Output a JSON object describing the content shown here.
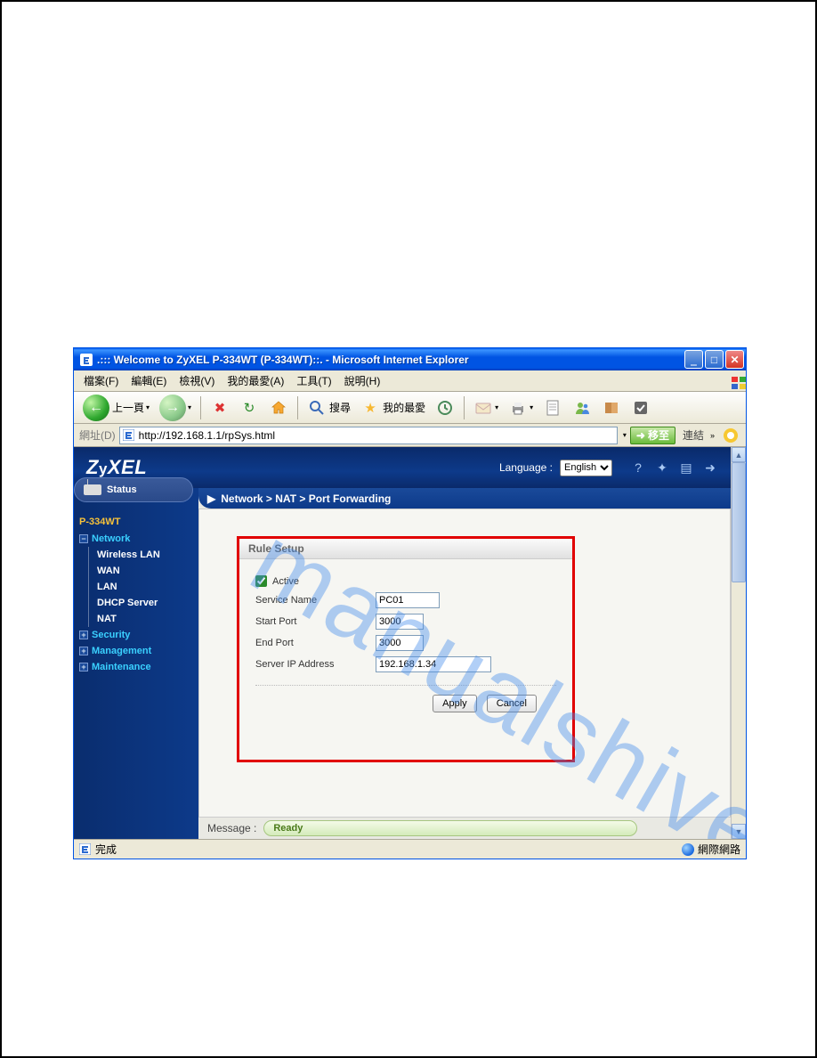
{
  "window": {
    "title": ".::: Welcome to ZyXEL P-334WT (P-334WT)::. - Microsoft Internet Explorer"
  },
  "menu": {
    "file": "檔案(F)",
    "edit": "編輯(E)",
    "view": "檢視(V)",
    "favorites": "我的最愛(A)",
    "tools": "工具(T)",
    "help": "說明(H)"
  },
  "toolbar": {
    "back": "上一頁",
    "search": "搜尋",
    "favorites": "我的最愛"
  },
  "addressbar": {
    "label": "網址(D)",
    "url": "http://192.168.1.1/rpSys.html",
    "go": "移至",
    "links": "連結"
  },
  "router": {
    "logo": "ZyXEL",
    "language_label": "Language :",
    "language_value": "English",
    "breadcrumb": "Network > NAT > Port Forwarding",
    "status": "Status",
    "device": "P-334WT",
    "nav": {
      "network": "Network",
      "wireless": "Wireless LAN",
      "wan": "WAN",
      "lan": "LAN",
      "dhcp": "DHCP Server",
      "nat": "NAT",
      "security": "Security",
      "management": "Management",
      "maintenance": "Maintenance"
    },
    "rule": {
      "title": "Rule Setup",
      "active": "Active",
      "service_name_label": "Service Name",
      "service_name_value": "PC01",
      "start_port_label": "Start Port",
      "start_port_value": "3000",
      "end_port_label": "End Port",
      "end_port_value": "3000",
      "server_ip_label": "Server IP Address",
      "server_ip_value": "192.168.1.34",
      "apply": "Apply",
      "cancel": "Cancel"
    },
    "message_label": "Message :",
    "message_value": "Ready"
  },
  "statusbar": {
    "done": "完成",
    "zone": "網際網路"
  },
  "watermark": "manualshive.com"
}
